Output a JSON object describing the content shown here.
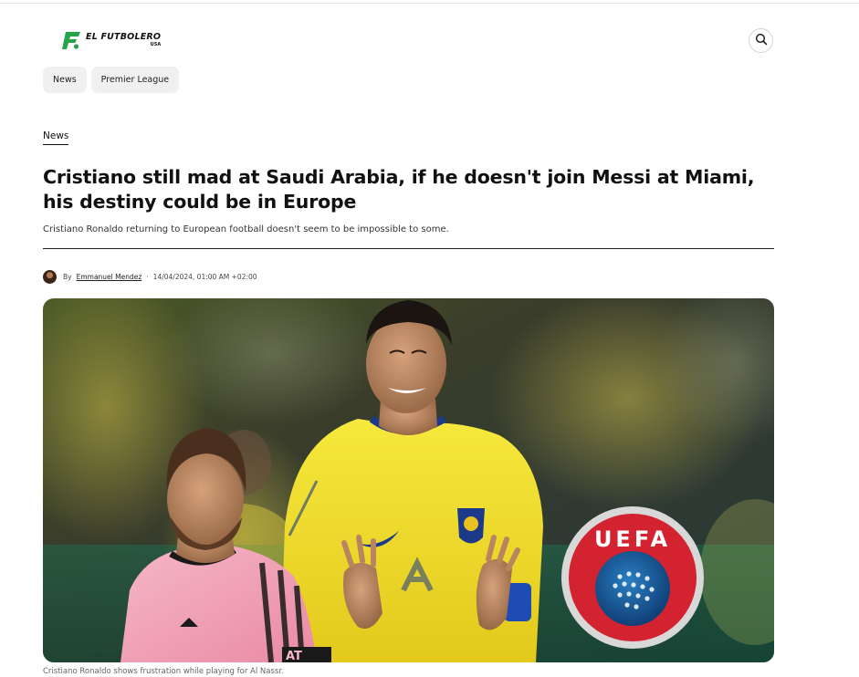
{
  "site": {
    "name": "EL FUTBOLERO",
    "sub": "USA",
    "brand_color": "#27a34a"
  },
  "nav": {
    "items": [
      {
        "label": "News"
      },
      {
        "label": "Premier League"
      }
    ]
  },
  "article": {
    "category": "News",
    "title": "Cristiano still mad at Saudi Arabia, if he doesn't join Messi at Miami, his destiny could be in Europe",
    "dek": "Cristiano Ronaldo returning to European football doesn't seem to be impossible to some.",
    "byline_prefix": "By",
    "author": "Emmanuel Mendez",
    "separator": "·",
    "timestamp": "14/04/2024, 01:00 AM +02:00"
  },
  "hero": {
    "badge_text": "UEFA",
    "shirt_text": "AT",
    "caption": "Cristiano Ronaldo shows frustration while playing for Al Nassr."
  },
  "icons": {
    "search": "search-icon",
    "logo": "logo-icon"
  }
}
